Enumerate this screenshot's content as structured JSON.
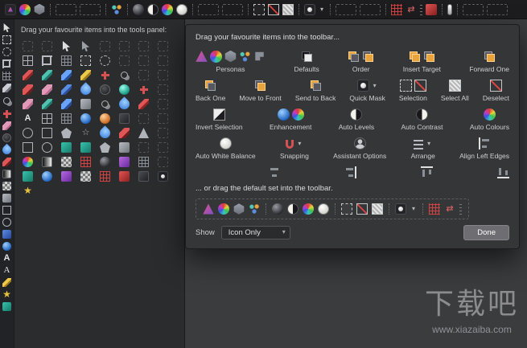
{
  "colors": {
    "topbar": "#1d1d1f",
    "tools_panel": "#2b2c2e",
    "dialog": "#353638",
    "accent_orange": "#e8a33d",
    "selection_red": "#e04444",
    "canvas": "#3b3c3e"
  },
  "top_toolbar": {
    "items": [
      "app-persona",
      "color-wheel",
      "hexagon",
      "sep",
      "drop",
      "drop",
      "sep",
      "nodes",
      "sep",
      "dark-sphere",
      "contrast-circle",
      "color-wheel",
      "white-circle",
      "sep",
      "drop",
      "drop",
      "sep",
      "marquee",
      "deselect",
      "select-all",
      "sep",
      "quick-mask",
      "dropdown-arrow",
      "sep",
      "drop",
      "drop",
      "sep",
      "red-grid",
      "red-arrows",
      "dots",
      "red-swatch",
      "sep",
      "thermo",
      "sep",
      "drop",
      "drop"
    ]
  },
  "tool_strip": {
    "icons": [
      "cursor",
      "marquee",
      "lasso",
      "crop",
      "mesh",
      "brush-gray",
      "clone",
      "heal",
      "eraser",
      "dodge",
      "droplet",
      "brush-red",
      "gradient",
      "checker",
      "gray-swatch",
      "square-shape",
      "circle-shape",
      "blue-swatch",
      "blue-sphere",
      "text",
      "text-serif",
      "pencil-yellow",
      "star-yellow",
      "teal-swatch"
    ]
  },
  "tools_panel": {
    "hint": "Drag your favourite items into the tools panel:",
    "grid": [
      [
        "slot",
        "slot",
        "cursor",
        "cursor-alt",
        "slot",
        "slot",
        "slot",
        "slot"
      ],
      [
        "table",
        "crop",
        "mesh",
        "marquee",
        "lasso",
        "slot",
        "slot",
        "slot"
      ],
      [
        "pencil-red",
        "pencil-teal",
        "brush-blue",
        "pencil-yellow",
        "heal",
        "clone",
        "slot",
        "slot"
      ],
      [
        "brush-red",
        "eraser",
        "pencil-blue",
        "droplet",
        "dodge",
        "teal-sphere",
        "heal",
        "slot"
      ],
      [
        "eraser",
        "pencil-teal",
        "brush-blue",
        "gray-swatch",
        "clone",
        "droplet",
        "pencil-red",
        "slot"
      ],
      [
        "text",
        "table",
        "mesh",
        "blue-sphere",
        "orange-sphere",
        "dark-swatch",
        "slot",
        "slot"
      ],
      [
        "circle-shape",
        "square-shape",
        "polygon-shape",
        "star-shape",
        "droplet",
        "brush-red",
        "triangle-shape",
        "slot"
      ],
      [
        "square-shape",
        "circle-shape",
        "teal-swatch",
        "teal-swatch",
        "polygon-shape",
        "gray-swatch",
        "slot",
        "slot"
      ],
      [
        "color-wheel",
        "gradient",
        "checker",
        "red-grid",
        "dark-sphere",
        "purple-swatch",
        "mesh",
        "slot"
      ],
      [
        "teal-swatch",
        "blue-sphere",
        "purple-swatch",
        "checker",
        "red-grid",
        "red-swatch",
        "dark-swatch",
        "quick-mask"
      ],
      [
        "star-yellow",
        "blank",
        "blank",
        "blank",
        "blank",
        "blank",
        "blank",
        "blank"
      ]
    ]
  },
  "dialog": {
    "title": "Drag your favourite items into the toolbar...",
    "rows": [
      [
        {
          "label": "Personas",
          "icons": [
            "photo-persona",
            "color-wheel",
            "hexagon",
            "nodes",
            "export-slice"
          ]
        },
        {
          "label": "Defaults",
          "icons": [
            "defaults"
          ]
        },
        {
          "label": "Order",
          "icons": [
            "stack-back",
            "stack-front"
          ]
        },
        {
          "label": "Insert Target",
          "icons": [
            "insert-inside",
            "insert-behind"
          ]
        },
        {
          "label": "Forward One",
          "icons": [
            "stack-forward"
          ]
        }
      ],
      [
        {
          "label": "Back One",
          "icons": [
            "stack-backone"
          ]
        },
        {
          "label": "Move to Front",
          "icons": [
            "stack-front"
          ]
        },
        {
          "label": "Send to Back",
          "icons": [
            "stack-back"
          ]
        },
        {
          "label": "Quick Mask",
          "icons": [
            "quick-mask",
            "dropdown-arrow"
          ]
        },
        {
          "label": "Selection",
          "icons": [
            "marquee",
            "deselect"
          ]
        },
        {
          "label": "Select All",
          "icons": [
            "select-all"
          ]
        },
        {
          "label": "Deselect",
          "icons": [
            "deselect"
          ]
        }
      ],
      [
        {
          "label": "Invert Selection",
          "icons": [
            "invert"
          ]
        },
        {
          "label": "Enhancement",
          "icons": [
            "blue-sphere",
            "enhance-wheel"
          ]
        },
        {
          "label": "Auto Levels",
          "icons": [
            "contrast-circle"
          ]
        },
        {
          "label": "Auto Contrast",
          "icons": [
            "contrast-circle-alt"
          ]
        },
        {
          "label": "Auto Colours",
          "icons": [
            "enhance-wheel"
          ]
        }
      ],
      [
        {
          "label": "Auto White Balance",
          "icons": [
            "white-circle"
          ]
        },
        {
          "label": "Snapping",
          "icons": [
            "magnet",
            "dropdown-arrow"
          ]
        },
        {
          "label": "Assistant Options",
          "icons": [
            "assistant"
          ]
        },
        {
          "label": "Arrange",
          "icons": [
            "arrange",
            "dropdown-arrow"
          ]
        },
        {
          "label": "Align Left Edges",
          "icons": [
            "align-left"
          ]
        }
      ],
      [
        {
          "label": "",
          "icons": [
            "align-center"
          ]
        },
        {
          "label": "",
          "icons": [
            "align-right"
          ]
        },
        {
          "label": "",
          "icons": [
            "align-top"
          ]
        },
        {
          "label": "",
          "icons": [
            "align-bottom"
          ]
        }
      ]
    ],
    "default_hint": "... or drag the default set into the toolbar.",
    "default_set_icons": [
      "photo-persona",
      "color-wheel",
      "hexagon",
      "nodes",
      "sep",
      "dark-sphere",
      "contrast-circle",
      "color-wheel",
      "white-circle",
      "sep",
      "marquee",
      "deselect",
      "select-all",
      "sep",
      "quick-mask",
      "dropdown-arrow",
      "sep",
      "red-grid",
      "red-arrows",
      "dots"
    ],
    "footer": {
      "show_label": "Show",
      "display_mode": "Icon Only",
      "done_label": "Done"
    }
  },
  "watermark": {
    "title": "下载吧",
    "url": "www.xiazaiba.com"
  }
}
